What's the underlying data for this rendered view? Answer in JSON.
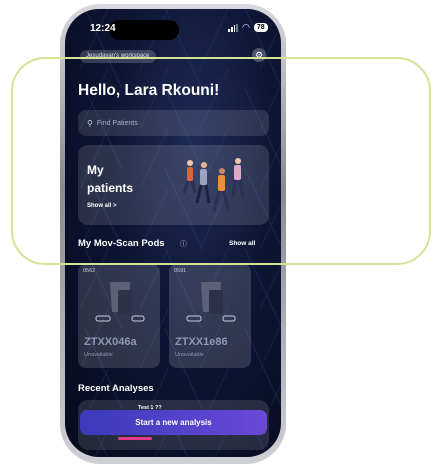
{
  "status_bar": {
    "time": "12:24",
    "battery": "78"
  },
  "header": {
    "workspace": "Jesudayan's workspace",
    "greeting": "Hello, Lara Rkouni!"
  },
  "search": {
    "placeholder": "Find Patients"
  },
  "patients_card": {
    "title": "My patients",
    "show_all": "Show all >"
  },
  "pods_section": {
    "title": "My Mov-Scan Pods",
    "show_all": "Show all",
    "pods": [
      {
        "id": "0562",
        "name": "ZTXX046a",
        "status": "Unavailable"
      },
      {
        "id": "0591",
        "name": "ZTXX1e86",
        "status": "Unavailable"
      }
    ]
  },
  "recent": {
    "title": "Recent Analyses",
    "item_label": "Test 1 ??"
  },
  "cta": {
    "label": "Start a new analysis"
  },
  "colors": {
    "highlight": "#d6e294",
    "cta_start": "#3a3bb8",
    "cta_end": "#6a49d9",
    "home_indicator": "#e6398a"
  }
}
